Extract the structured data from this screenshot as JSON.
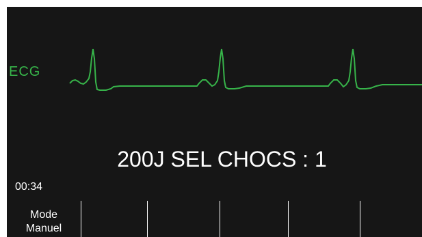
{
  "waveform": {
    "lead_label": "ECG",
    "color": "#37b44a"
  },
  "message": "200J SEL CHOCS : 1",
  "timer": "00:34",
  "softkeys": [
    {
      "line1": "Mode",
      "line2": "Manuel"
    },
    {
      "line1": "",
      "line2": ""
    },
    {
      "line1": "",
      "line2": ""
    },
    {
      "line1": "",
      "line2": ""
    },
    {
      "line1": "",
      "line2": ""
    },
    {
      "line1": "",
      "line2": ""
    }
  ]
}
